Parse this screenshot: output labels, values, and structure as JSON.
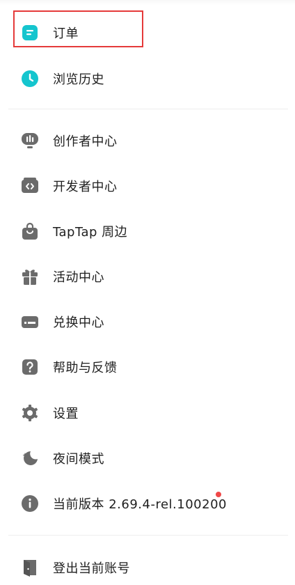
{
  "accent_teal": "#15c5ce",
  "icon_gray": "#6b6b6b",
  "highlight_color": "#e53a3a",
  "items": [
    {
      "label": "订单",
      "icon": "order-icon"
    },
    {
      "label": "浏览历史",
      "icon": "clock-icon"
    },
    {
      "label": "创作者中心",
      "icon": "creator-icon"
    },
    {
      "label": "开发者中心",
      "icon": "developer-icon"
    },
    {
      "label": "TapTap 周边",
      "icon": "shopping-bag-icon"
    },
    {
      "label": "活动中心",
      "icon": "gift-icon"
    },
    {
      "label": "兑换中心",
      "icon": "redeem-card-icon"
    },
    {
      "label": "帮助与反馈",
      "icon": "help-icon"
    },
    {
      "label": "设置",
      "icon": "gear-icon"
    },
    {
      "label": "夜间模式",
      "icon": "moon-icon"
    },
    {
      "label": "当前版本 2.69.4-rel.100200",
      "icon": "info-icon"
    },
    {
      "label": "登出当前账号",
      "icon": "logout-icon"
    }
  ]
}
